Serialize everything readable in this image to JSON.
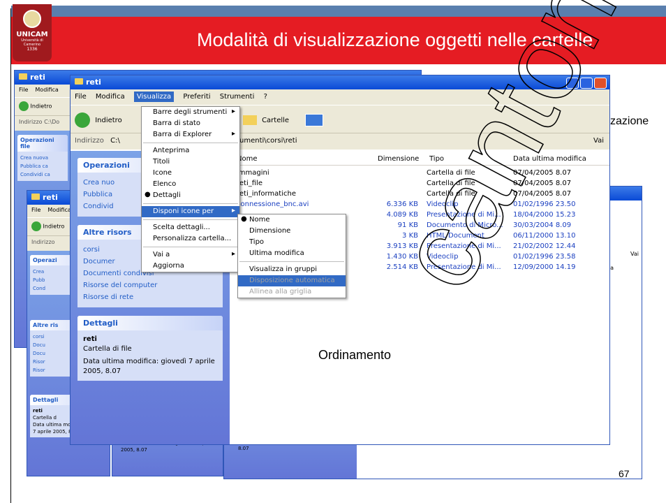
{
  "slide": {
    "title": "Modalità di visualizzazione oggetti nelle cartelle",
    "logo_text": "UNICAM",
    "logo_sub": "Università di Camerino",
    "logo_year": "1336",
    "caption_ordinamento": "Ordinamento",
    "caption_zazione": "zazione",
    "page_number": "67",
    "watermark": "cantoni"
  },
  "window": {
    "title": "reti",
    "menubar": [
      "File",
      "Modifica",
      "Visualizza",
      "Preferiti",
      "Strumenti",
      "?"
    ],
    "toolbar": {
      "back": "Indietro",
      "folders": "Cartelle"
    },
    "address_label": "Indirizzo",
    "address_value": "C:\\",
    "address_path": "umenti\\corsi\\reti",
    "go_label": "Vai",
    "columns": [
      "Nome",
      "Dimensione",
      "Tipo",
      "Data ultima modifica"
    ],
    "files": [
      {
        "name": "immagini",
        "size": "",
        "type": "Cartella di file",
        "date": "07/04/2005 8.07"
      },
      {
        "name": "reti_file",
        "size": "",
        "type": "Cartella di file",
        "date": "07/04/2005 8.07"
      },
      {
        "name": "reti_informatiche",
        "size": "",
        "type": "Cartella di file",
        "date": "07/04/2005 8.07"
      },
      {
        "name": "connessione_bnc.avi",
        "size": "6.336 KB",
        "type": "Videoclip",
        "date": "01/02/1996 23.50"
      },
      {
        "name": "",
        "size": "4.089 KB",
        "type": "Presentazione di Mi...",
        "date": "18/04/2000 15.23"
      },
      {
        "name": "",
        "size": "91 KB",
        "type": "Documento di Micro...",
        "date": "30/03/2004 8.09"
      },
      {
        "name": "",
        "size": "3 KB",
        "type": "HTML Document",
        "date": "06/11/2000 13.10"
      },
      {
        "name": "",
        "size": "3.913 KB",
        "type": "Presentazione di Mi...",
        "date": "21/02/2002 12.44"
      },
      {
        "name": "",
        "size": "1.430 KB",
        "type": "Videoclip",
        "date": "01/02/1996 23.58"
      },
      {
        "name": "",
        "size": "2.514 KB",
        "type": "Presentazione di Mi...",
        "date": "12/09/2000 14.19"
      }
    ],
    "sidebar": {
      "ops_title": "Operazioni",
      "ops_items": [
        "Crea nuo",
        "Pubblica",
        "Condivid"
      ],
      "other_title": "Altre risors",
      "other_items": [
        "corsi",
        "Documer",
        "Documenti condivisi",
        "Risorse del computer",
        "Risorse di rete"
      ],
      "details_title": "Dettagli",
      "details_name": "reti",
      "details_type": "Cartella di file",
      "details_date": "Data ultima modifica: giovedì 7 aprile 2005, 8.07"
    }
  },
  "back_windows": {
    "title": "reti",
    "menu_file": "File",
    "menu_modifica": "Modifica",
    "back": "Indietro",
    "address": "Indirizzo",
    "address_value": "C:\\Do",
    "ops_title": "Operazioni file",
    "ops_items": [
      "Crea nuova",
      "Pubblica ca",
      "Condividi ca"
    ],
    "other_title": "Altre ris",
    "other_items": [
      "corsi",
      "Docu",
      "Docu",
      "Risor",
      "Risor"
    ],
    "details_title": "Dettagli",
    "details_name": "reti",
    "details_type": "Cartella d",
    "details_date": "Data ultima modifica: giovedì 7 aprile 2005, 8.07",
    "right_vai": "Vai",
    "right_fica": "fica",
    "opera_short": "Operazi",
    "crea_short": "Crea",
    "pubb_short": "Pubb",
    "cond_short": "Cond"
  },
  "view_menu": {
    "items": [
      {
        "label": "Barre degli strumenti",
        "submenu": true
      },
      {
        "label": "Barra di stato"
      },
      {
        "label": "Barra di Explorer",
        "submenu": true
      },
      {
        "sep": true
      },
      {
        "label": "Anteprima"
      },
      {
        "label": "Titoli"
      },
      {
        "label": "Icone"
      },
      {
        "label": "Elenco"
      },
      {
        "label": "Dettagli",
        "checked": true
      },
      {
        "sep": true
      },
      {
        "label": "Disponi icone per",
        "submenu": true,
        "selected": true
      },
      {
        "sep": true
      },
      {
        "label": "Scelta dettagli..."
      },
      {
        "label": "Personalizza cartella..."
      },
      {
        "sep": true
      },
      {
        "label": "Vai a",
        "submenu": true
      },
      {
        "label": "Aggiorna"
      }
    ]
  },
  "arrange_menu": {
    "items": [
      {
        "label": "Nome",
        "checked": true
      },
      {
        "label": "Dimensione"
      },
      {
        "label": "Tipo"
      },
      {
        "label": "Ultima modifica"
      },
      {
        "sep": true
      },
      {
        "label": "Visualizza in gruppi"
      },
      {
        "label": "Disposizione automatica",
        "selected": true,
        "disabled": true
      },
      {
        "label": "Allinea alla griglia",
        "disabled": true
      }
    ]
  }
}
